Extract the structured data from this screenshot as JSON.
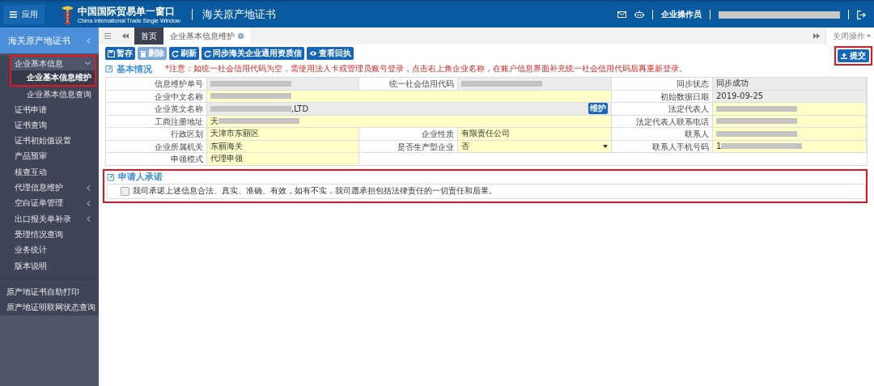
{
  "header": {
    "menu_button": "应用",
    "brand_cn": "中国国际贸易单一窗口",
    "brand_en": "China International Trade Single Window",
    "system_title": "海关原产地证书",
    "user_role": "企业操作员"
  },
  "sidebar": {
    "title": "海关原产地证书",
    "items": [
      {
        "label": "企业基本信息",
        "expandable": true,
        "expanded": true,
        "selected": false,
        "children": [
          {
            "label": "企业基本信息维护",
            "selected": true
          },
          {
            "label": "企业基本信息查询",
            "selected": false
          }
        ]
      },
      {
        "label": "证书申请",
        "expandable": false,
        "selected": false
      },
      {
        "label": "证书查询",
        "expandable": false,
        "selected": false
      },
      {
        "label": "证书初始值设置",
        "expandable": false,
        "selected": false
      },
      {
        "label": "产品预审",
        "expandable": false,
        "selected": false
      },
      {
        "label": "核查互动",
        "expandable": false,
        "selected": false
      },
      {
        "label": "代理信息维护",
        "expandable": true,
        "expanded": false,
        "selected": false
      },
      {
        "label": "空白证单管理",
        "expandable": true,
        "expanded": false,
        "selected": false
      },
      {
        "label": "出口报关单补录",
        "expandable": true,
        "expanded": false,
        "selected": false
      },
      {
        "label": "受理情况查询",
        "expandable": false,
        "selected": false
      },
      {
        "label": "业务统计",
        "expandable": false,
        "selected": false
      },
      {
        "label": "版本说明",
        "expandable": false,
        "selected": false
      }
    ],
    "footer_items": [
      {
        "label": "原产地证书自助打印",
        "selected": false
      },
      {
        "label": "原产地证明联网状态查询",
        "selected": false
      }
    ]
  },
  "tabs": [
    {
      "label": "首页",
      "kind": "home",
      "selected": false
    },
    {
      "label": "企业基本信息维护",
      "kind": "closable",
      "selected": true
    }
  ],
  "close_menu": "关闭操作",
  "toolbar": [
    {
      "label": "暂存",
      "disabled": false
    },
    {
      "label": "删除",
      "disabled": true
    },
    {
      "label": "刷新",
      "disabled": false
    },
    {
      "label": "同步海关企业通用资质信",
      "disabled": false
    },
    {
      "label": "查看回执",
      "disabled": false
    }
  ],
  "submit_button": "提交",
  "basic_section": {
    "title": "基本情况",
    "notice": "*注意：如统一社会信用代码为空，需使用法人卡或管理员账号登录，点击右上角企业名称，在账户信息界面补充统一社会信用代码后再重新登录。",
    "rows": [
      {
        "fields": [
          {
            "label": "信息维护单号",
            "kind": "input",
            "editable": false,
            "redacted": true
          },
          {
            "label": "统一社会信用代码",
            "kind": "input",
            "editable": false,
            "redacted": true
          },
          {
            "label": "同步状态",
            "kind": "input",
            "editable": false,
            "value": "同步成功",
            "redacted": false
          }
        ]
      },
      {
        "fields": [
          {
            "label": "企业中文名称",
            "kind": "input",
            "editable": true,
            "redacted": true
          },
          {
            "label": "初始数据日期",
            "kind": "input",
            "editable": false,
            "value": "2019-09-25",
            "redacted": false
          }
        ]
      },
      {
        "fields": [
          {
            "label": "企业英文名称",
            "kind": "input",
            "editable": false,
            "redacted": true,
            "value_after": ",LTD",
            "action": "维护"
          },
          {
            "label": "法定代表人",
            "kind": "input",
            "editable": true,
            "redacted": true
          }
        ]
      },
      {
        "fields": [
          {
            "label": "工商注册地址",
            "kind": "input",
            "editable": true,
            "value": "天",
            "redacted": true
          },
          {
            "label": "法定代表人联系电话",
            "kind": "input",
            "editable": true,
            "redacted": true
          }
        ]
      },
      {
        "fields": [
          {
            "label": "行政区划",
            "kind": "input",
            "editable": true,
            "value": "天津市东丽区",
            "redacted": false
          },
          {
            "label": "企业性质",
            "kind": "input",
            "editable": true,
            "value": "有限责任公司",
            "redacted": false
          },
          {
            "label": "联系人",
            "kind": "input",
            "editable": true,
            "redacted": true
          }
        ]
      },
      {
        "fields": [
          {
            "label": "企业所属机关",
            "kind": "input",
            "editable": true,
            "value": "东丽海关",
            "redacted": false
          },
          {
            "label": "是否生产型企业",
            "kind": "select",
            "editable": true,
            "value": "否"
          },
          {
            "label": "联系人手机号码",
            "kind": "input",
            "editable": true,
            "value": "1",
            "redacted": true
          }
        ]
      },
      {
        "fields": [
          {
            "label": "申领模式",
            "kind": "input",
            "editable": true,
            "value": "代理申领",
            "redacted": false
          }
        ]
      }
    ]
  },
  "commitment_section": {
    "title": "申请人承诺",
    "checked": false,
    "text": "我司承诺上述信息合法、真实、准确、有效，如有不实，我司愿承担包括法律责任的一切责任和后果。"
  }
}
